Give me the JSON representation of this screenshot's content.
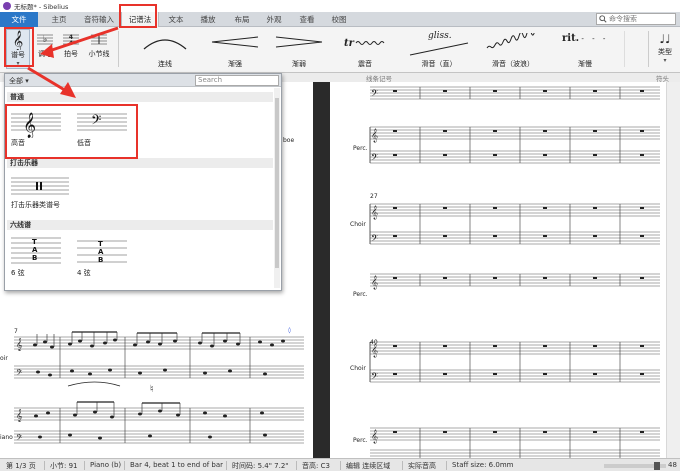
{
  "window": {
    "title": "无标题* - Sibelius"
  },
  "tabs": [
    {
      "label": "文件"
    },
    {
      "label": "主页"
    },
    {
      "label": "音符输入"
    },
    {
      "label": "记谱法"
    },
    {
      "label": "文本"
    },
    {
      "label": "播放"
    },
    {
      "label": "布局"
    },
    {
      "label": "外观"
    },
    {
      "label": "查看"
    },
    {
      "label": "校图"
    }
  ],
  "command_search": {
    "placeholder": "命令搜索"
  },
  "ribbon": {
    "clef_label": "谱号",
    "key_label": "调号",
    "time_label": "拍号",
    "barline_label": "小节线",
    "lines": [
      {
        "label": "连线"
      },
      {
        "label": "渐强"
      },
      {
        "label": "渐弱"
      },
      {
        "label": "震音"
      },
      {
        "label": "滑音（直）"
      },
      {
        "label": "滑音（波浪）"
      },
      {
        "label": "渐慢"
      }
    ],
    "gliss_text": "gliss.",
    "rit_text": "rit.",
    "noteheads_label": "类型",
    "group_lines": "线条记号",
    "group_noteheads": "符头"
  },
  "clef_gallery": {
    "filter": "全部",
    "search_placeholder": "Search",
    "sections": [
      {
        "title": "普通",
        "items": [
          {
            "label": "高音"
          },
          {
            "label": "低音"
          }
        ]
      },
      {
        "title": "打击乐器",
        "items": [
          {
            "label": "打击乐器类谱号"
          }
        ]
      },
      {
        "title": "六线谱",
        "items": [
          {
            "label": "6 弦"
          },
          {
            "label": "4 弦"
          }
        ]
      }
    ],
    "tab_text": "TAB"
  },
  "score": {
    "measure_7": "7",
    "measure_27": "27",
    "measure_40": "40",
    "instr_choir": "Choir",
    "instr_perc": "Perc.",
    "left_choir": "oir",
    "left_perc": "rc.",
    "left_piano": "iano",
    "left_oboe": "boe"
  },
  "status": {
    "page": "第 1/3 页",
    "bars": "小节: 91",
    "instrument": "Piano (b)",
    "position": "Bar 4, beat 1 to end of bar",
    "timecode": "时间码: 5.4\" 7.2\"",
    "pitch": "音高: C3",
    "edit_mode": "编辑 连续区域",
    "concert": "实际音高",
    "staff_size": "Staff size: 6.0mm",
    "zoom": "48"
  }
}
